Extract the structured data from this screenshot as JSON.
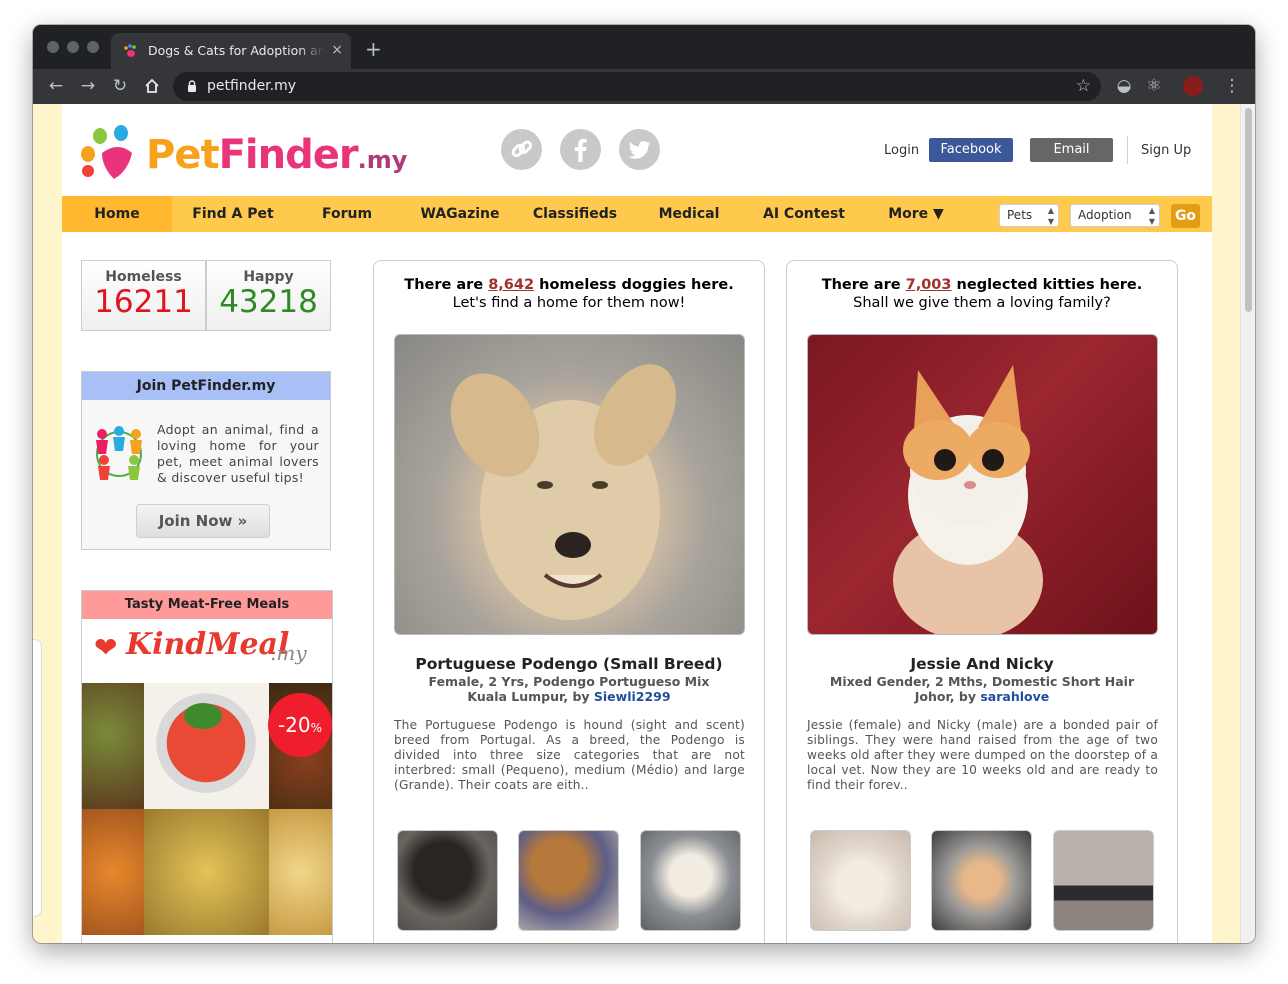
{
  "browser": {
    "tab_title": "Dogs & Cats for Adoption and Sale",
    "url": "petfinder.my",
    "new_tab": "+",
    "close": "×"
  },
  "site": {
    "logo_main": "PetFinder",
    "logo_suffix": ".my",
    "social": [
      "link-icon",
      "facebook-icon",
      "twitter-icon"
    ],
    "auth": {
      "login": "Login",
      "facebook": "Facebook",
      "email": "Email",
      "signup": "Sign Up"
    }
  },
  "nav": {
    "items": [
      "Home",
      "Find A Pet",
      "Forum",
      "WAGazine",
      "Classifieds",
      "Medical",
      "AI Contest",
      "More ▼"
    ],
    "select_type": "Pets",
    "select_mode": "Adoption",
    "go": "Go"
  },
  "stats": {
    "homeless_label": "Homeless",
    "homeless_value": "16211",
    "happy_label": "Happy",
    "happy_value": "43218"
  },
  "join": {
    "title": "Join PetFinder.my",
    "text": "Adopt an animal, find a loving home for your pet, meet animal lovers & discover useful tips!",
    "button": "Join Now »"
  },
  "ad": {
    "title": "Tasty Meat-Free Meals",
    "brand": "KindMeal",
    "brand_suffix": ".my",
    "discount": "-20",
    "discount_unit": "%"
  },
  "dogs": {
    "head_pre": "There are ",
    "count": "8,642",
    "head_post": " homeless doggies here.",
    "sub": "Let's find a home for them now!",
    "name": "Portuguese Podengo (Small Breed)",
    "meta1": "Female, 2 Yrs, Podengo Portugueso Mix",
    "meta2_pre": "Kuala Lumpur, by ",
    "user": "Siewli2299",
    "desc": "The Portuguese Podengo is hound (sight and scent) breed from Portugal. As a breed, the Podengo is divided into three size categories that are not interbred: small (Pequeno), medium (Médio) and large (Grande). Their coats are eith.."
  },
  "cats": {
    "head_pre": "There are ",
    "count": "7,003",
    "head_post": " neglected kitties here.",
    "sub": "Shall we give them a loving family?",
    "name": "Jessie And Nicky",
    "meta1": "Mixed Gender, 2 Mths, Domestic Short Hair",
    "meta2_pre": "Johor, by ",
    "user": "sarahlove",
    "desc": "Jessie (female) and Nicky (male) are a bonded pair of siblings. They were hand raised from the age of two weeks old after they were dumped on the doorstep of a local vet. Now they are 10 weeks old and are ready to find their forev.."
  },
  "colors": {
    "nav": "#ffc94d",
    "nav_active": "#ffb830",
    "homeless": "#e0141e",
    "happy": "#2e8b22",
    "link_red": "#a0312b",
    "facebook": "#3b5998"
  }
}
